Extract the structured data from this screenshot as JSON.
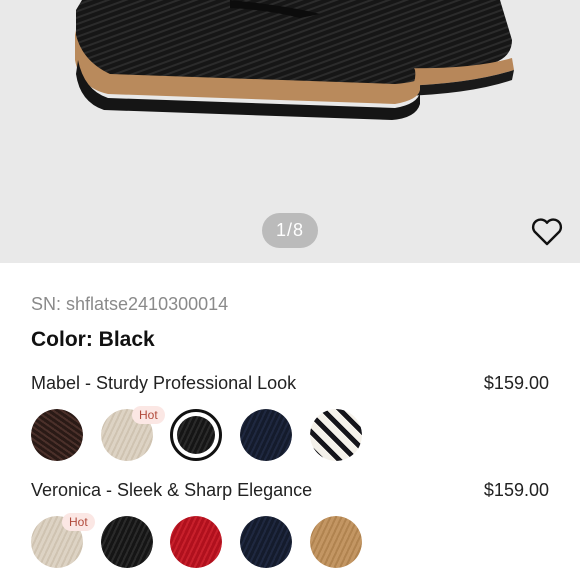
{
  "gallery": {
    "counter": "1/8",
    "favorite_icon": "heart-outline-icon"
  },
  "product": {
    "sn": "SN: shflatse2410300014",
    "color_line": "Color: Black"
  },
  "styles": [
    {
      "title": "Mabel - Sturdy Professional Look",
      "price": "$159.00",
      "swatches": [
        {
          "name": "brown",
          "hot": null
        },
        {
          "name": "cream",
          "hot": "Hot"
        },
        {
          "name": "black",
          "hot": null,
          "selected": true
        },
        {
          "name": "navy",
          "hot": null
        },
        {
          "name": "stripe",
          "hot": null
        }
      ]
    },
    {
      "title": "Veronica - Sleek & Sharp Elegance",
      "price": "$159.00",
      "swatches": [
        {
          "name": "cream",
          "hot": "Hot"
        },
        {
          "name": "black",
          "hot": null
        },
        {
          "name": "red",
          "hot": null
        },
        {
          "name": "navy",
          "hot": null
        },
        {
          "name": "tan",
          "hot": null
        }
      ]
    }
  ]
}
